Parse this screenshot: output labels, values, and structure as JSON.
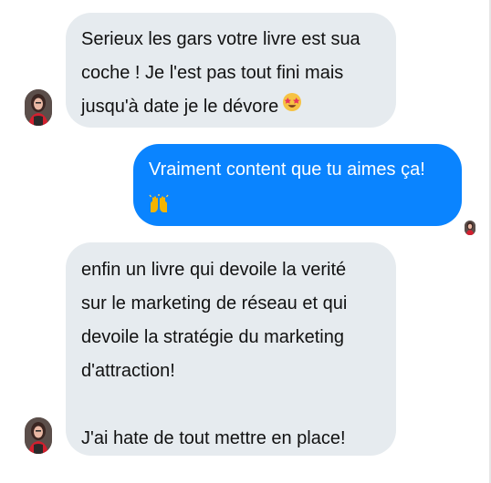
{
  "thread": {
    "messages": [
      {
        "direction": "incoming",
        "lines": [
          "Serieux les gars votre livre est sua",
          "coche ! Je l'est pas tout fini mais",
          "jusqu'à date je le dévore"
        ],
        "emoji": "star-struck-emoji"
      },
      {
        "direction": "outgoing",
        "lines": [
          "Vraiment content que tu aimes ça!"
        ],
        "emoji": "raising-hands-emoji"
      },
      {
        "direction": "incoming",
        "lines": [
          "enfin un livre qui devoile la verité",
          "sur le marketing de réseau et qui",
          "devoile la stratégie du marketing",
          "d'attraction!",
          "J'ai hate de tout mettre en place!"
        ]
      }
    ]
  },
  "colors": {
    "incoming_bubble": "#e6ebef",
    "outgoing_bubble": "#0a84ff",
    "incoming_text": "#111111",
    "outgoing_text": "#ffffff"
  },
  "icons": {
    "avatar": "user-avatar-icon",
    "star_struck": "star-struck-emoji",
    "raising_hands": "raising-hands-emoji"
  }
}
